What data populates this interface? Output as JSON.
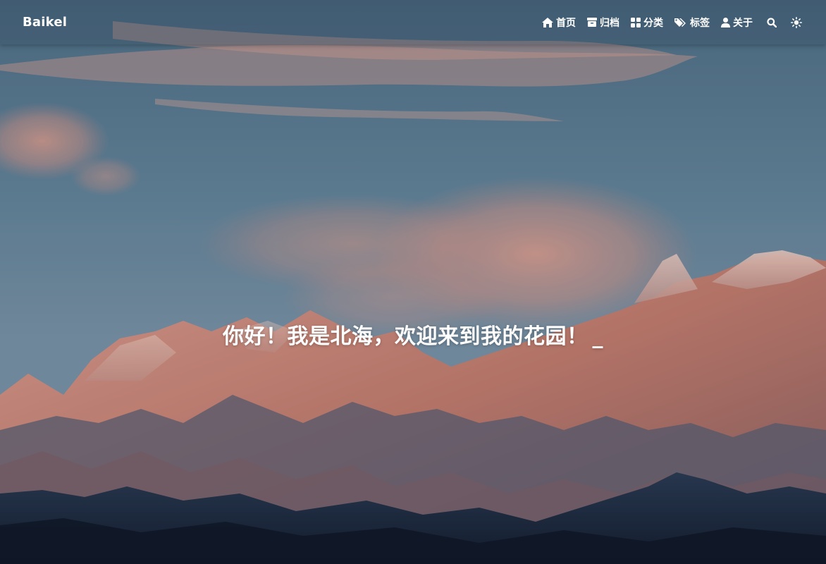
{
  "site": {
    "brand": "Baikel"
  },
  "nav": {
    "items": [
      {
        "label": "首页",
        "icon": "home-icon"
      },
      {
        "label": "归档",
        "icon": "archive-icon"
      },
      {
        "label": "分类",
        "icon": "grid-icon"
      },
      {
        "label": "标签",
        "icon": "tags-icon"
      },
      {
        "label": "关于",
        "icon": "user-icon"
      }
    ],
    "search_icon": "search-icon",
    "theme_icon": "sun-icon"
  },
  "hero": {
    "subtitle": "你好！我是北海，欢迎来到我的花园！",
    "cursor": "_"
  },
  "colors": {
    "sky": "#5b7d93",
    "peaks": "#d98b78",
    "text": "#ffffff"
  }
}
